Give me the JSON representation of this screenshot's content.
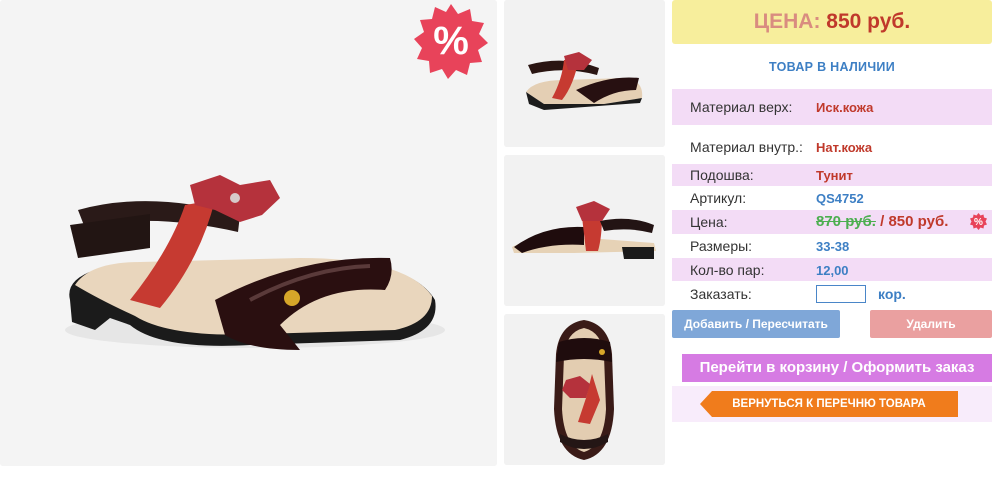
{
  "header": {
    "price_label": "ЦЕНА:",
    "price_value": "850 руб."
  },
  "badge": {
    "discount_symbol": "%",
    "color": "#e8435a"
  },
  "stock_status": "ТОВАР В НАЛИЧИИ",
  "specs": [
    {
      "key": "Материал верх:",
      "value": "Иск.кожа"
    },
    {
      "key": "Материал внутр.:",
      "value": "Нат.кожа"
    },
    {
      "key": "Подошва:",
      "value": "Тунит"
    },
    {
      "key": "Артикул:",
      "value": "QS4752"
    },
    {
      "key": "Цена:",
      "old_value": "870 руб.",
      "separator": " / ",
      "value": "850 руб."
    },
    {
      "key": "Размеры:",
      "value": "33-38"
    },
    {
      "key": "Кол-во пар:",
      "value": "12,00"
    },
    {
      "key": "Заказать:",
      "unit": "кор."
    }
  ],
  "order": {
    "quantity_value": ""
  },
  "buttons": {
    "add": "Добавить / Пересчитать",
    "remove": "Удалить",
    "cart": "Перейти в корзину / Оформить заказ",
    "back": "ВЕРНУТЬСЯ К ПЕРЕЧНЮ ТОВАРА"
  },
  "colors": {
    "header_bg": "#f7ee9c",
    "row_highlight": "#f3dcf6",
    "accent_blue": "#3d7fc4",
    "accent_red": "#c0392b",
    "back_button": "#f07c1c"
  }
}
